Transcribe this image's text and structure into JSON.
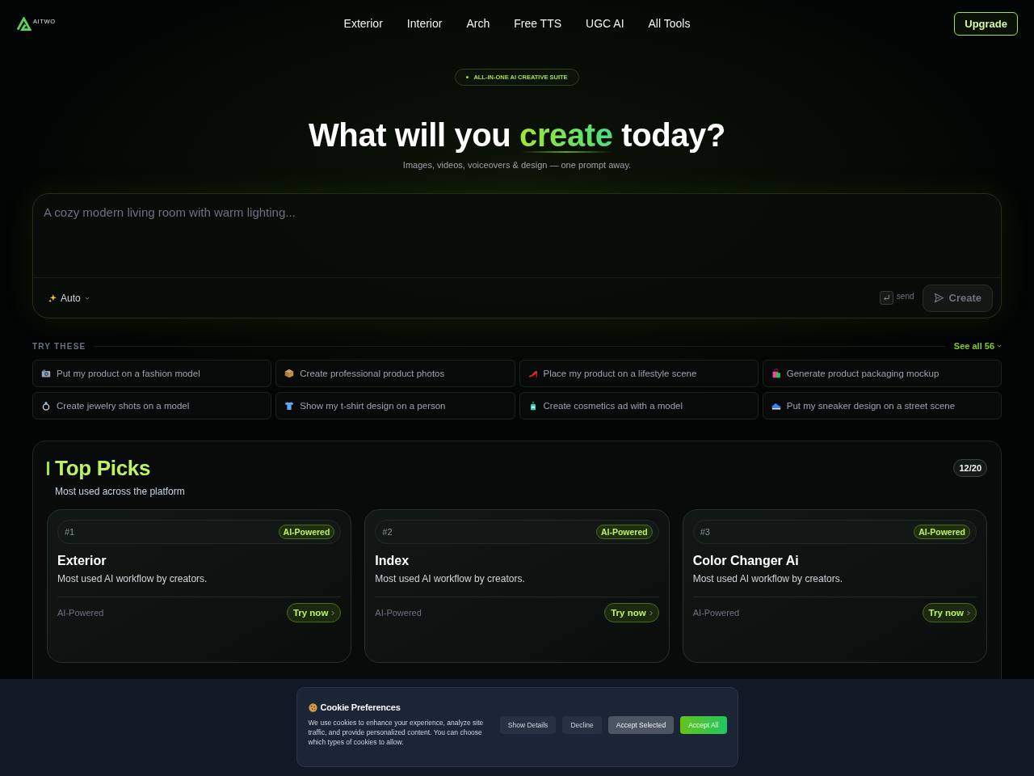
{
  "nav": {
    "logo_text": "AITWO",
    "links": [
      {
        "label": "Exterior"
      },
      {
        "label": "Interior"
      },
      {
        "label": "Arch"
      },
      {
        "label": "Free TTS"
      },
      {
        "label": "UGC AI"
      },
      {
        "label": "All Tools"
      }
    ],
    "upgrade_button": "Upgrade"
  },
  "hero": {
    "badge": "ALL-IN-ONE AI CREATIVE SUITE",
    "headline_before": "What will you",
    "headline_highlight": "create",
    "headline_after": "today?",
    "subtitle": "Images, videos, voiceovers & design — one prompt away."
  },
  "prompt": {
    "placeholder": "A cozy modern living room with warm lighting...",
    "mode": "Auto",
    "send_hint": "send",
    "create_button": {
      "label": "Create",
      "disabled": true
    }
  },
  "suggestions": {
    "title": "TRY THESE",
    "see_all": "See all 56",
    "items": [
      {
        "label": "Put my product on a fashion model"
      },
      {
        "label": "Create professional product photos"
      },
      {
        "label": "Place my product on a lifestyle scene"
      },
      {
        "label": "Generate product packaging mockup"
      },
      {
        "label": "Create jewelry shots on a model"
      },
      {
        "label": "Show my t-shirt design on a person"
      },
      {
        "label": "Create cosmetics ad with a model"
      },
      {
        "label": "Put my sneaker design on a street scene"
      }
    ]
  },
  "top_picks": {
    "title": "Top Picks",
    "subtitle": "Most used across the platform",
    "count": "12/20",
    "cards": [
      {
        "rank": "#1",
        "badge": "AI-Powered",
        "title": "Exterior",
        "description": "Most used AI workflow by creators.",
        "tag": "AI-Powered",
        "action": "Try now"
      },
      {
        "rank": "#2",
        "badge": "AI-Powered",
        "title": "Index",
        "description": "Most used AI workflow by creators.",
        "tag": "AI-Powered",
        "action": "Try now"
      },
      {
        "rank": "#3",
        "badge": "AI-Powered",
        "title": "Color Changer Ai",
        "description": "Most used AI workflow by creators.",
        "tag": "AI-Powered",
        "action": "Try now"
      }
    ]
  },
  "cookie": {
    "title": "Cookie Preferences",
    "body": "We use cookies to enhance your experience, analyze site traffic, and provide personalized content. You can choose which types of cookies to allow.",
    "buttons": [
      {
        "label": "Show Details",
        "kind": "secondary"
      },
      {
        "label": "Decline",
        "kind": "secondary"
      },
      {
        "label": "Accept Selected",
        "kind": "muted"
      },
      {
        "label": "Accept All",
        "kind": "primary"
      }
    ]
  }
}
